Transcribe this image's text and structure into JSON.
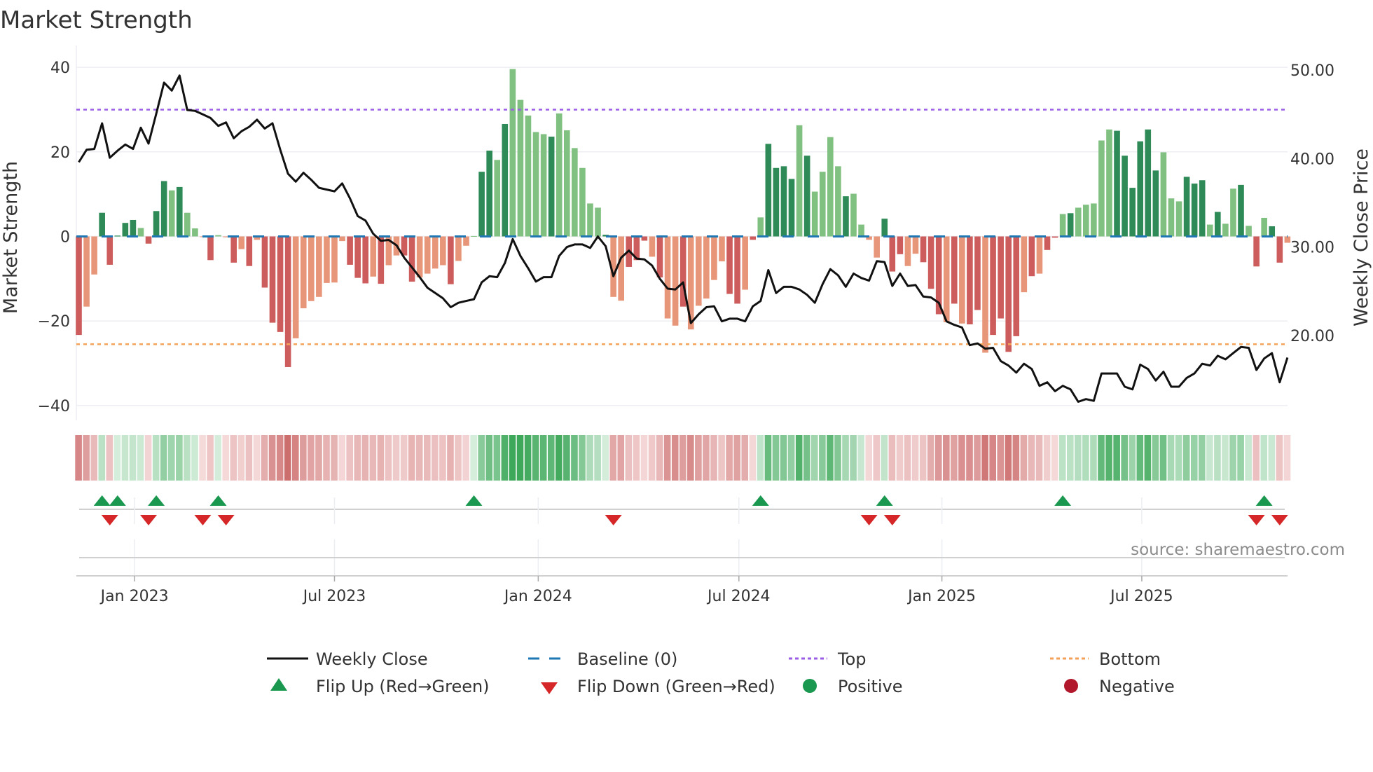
{
  "chart_data": {
    "type": "bar",
    "title": "Market Strength",
    "ylabel": "Market Strength",
    "y2label": "Weekly Close Price",
    "ylim": [
      -43.5,
      43.5
    ],
    "y2lim": [
      10.4,
      52.0
    ],
    "yticks": [
      {
        "v": 40,
        "label": "40"
      },
      {
        "v": 20,
        "label": "20"
      },
      {
        "v": 0,
        "label": "0"
      },
      {
        "v": -20,
        "label": "−20"
      },
      {
        "v": -40,
        "label": "−40"
      }
    ],
    "y2ticks": [
      {
        "v": 50,
        "label": "50.00"
      },
      {
        "v": 40,
        "label": "40.00"
      },
      {
        "v": 30,
        "label": "30.00"
      },
      {
        "v": 20,
        "label": "20.00"
      }
    ],
    "xticks": [
      {
        "week": 7.2,
        "label": "Jan 2023"
      },
      {
        "week": 33.0,
        "label": "Jul 2023"
      },
      {
        "week": 59.3,
        "label": "Jan 2024"
      },
      {
        "week": 85.2,
        "label": "Jul 2024"
      },
      {
        "week": 111.4,
        "label": "Jan 2025"
      },
      {
        "week": 137.2,
        "label": "Jul 2025"
      }
    ],
    "top_level": 30,
    "bottom_level": -25.5,
    "baseline": 0,
    "strength": [
      -23.3,
      -16.6,
      -9.0,
      5.6,
      -6.7,
      0.2,
      3.2,
      3.9,
      2.0,
      -1.7,
      6.0,
      13.1,
      10.9,
      11.7,
      5.6,
      1.9,
      -0.1,
      -5.6,
      0.3,
      -0.2,
      -6.2,
      -3.0,
      -7.0,
      -0.8,
      -12.1,
      -20.4,
      -22.6,
      -30.9,
      -24.1,
      -17.0,
      -15.3,
      -14.3,
      -11.0,
      -10.9,
      -1.1,
      -6.7,
      -9.8,
      -11.1,
      -9.5,
      -11.2,
      -6.8,
      -4.5,
      -4.5,
      -10.7,
      -9.7,
      -8.8,
      -7.6,
      -6.8,
      -11.3,
      -5.8,
      -2.2,
      0.1,
      15.3,
      20.3,
      18.1,
      26.6,
      39.6,
      32.3,
      28.6,
      24.7,
      24.2,
      23.6,
      29.1,
      25.1,
      20.9,
      16.2,
      7.8,
      6.8,
      0.4,
      -14.3,
      -15.2,
      -7.2,
      -5.6,
      -1.0,
      -4.8,
      -9.7,
      -19.4,
      -21.1,
      -16.6,
      -22.0,
      -16.4,
      -14.7,
      -10.3,
      -5.9,
      -13.6,
      -15.9,
      -12.6,
      -0.8,
      4.5,
      21.9,
      16.2,
      16.6,
      13.6,
      26.3,
      19.1,
      10.6,
      15.3,
      23.5,
      16.6,
      9.5,
      10.1,
      2.8,
      -0.8,
      -5.0,
      4.2,
      -8.3,
      -4.2,
      -7.0,
      -4.1,
      -6.1,
      -12.4,
      -18.4,
      -20.3,
      -15.9,
      -20.6,
      -20.8,
      -17.4,
      -27.5,
      -23.3,
      -19.4,
      -27.3,
      -23.6,
      -13.2,
      -9.4,
      -8.8,
      -3.2,
      -0.3,
      5.3,
      5.5,
      6.8,
      7.5,
      7.8,
      22.7,
      25.3,
      25.0,
      19.1,
      11.5,
      22.5,
      25.3,
      15.6,
      19.9,
      9.0,
      8.3,
      14.1,
      12.5,
      13.3,
      2.8,
      5.8,
      3.0,
      11.3,
      12.2,
      2.5,
      -7.1,
      4.4,
      2.4,
      -6.2,
      -1.5
    ],
    "shade": "dlldddddldddldllldlldldlddddllllllldddldlldd lllldlllddldllllldlllllldlldddldlldlllllddldlddddldlllldlllldddlldddldlddlddddldlddldlllllddddddllldddldlldldlddlddldl",
    "weekly_close": [
      39.6,
      41.0,
      41.1,
      44.0,
      40.1,
      40.9,
      41.6,
      41.1,
      43.5,
      41.7,
      45.1,
      48.6,
      47.7,
      49.4,
      45.5,
      45.4,
      45.0,
      44.6,
      43.7,
      44.1,
      42.3,
      43.1,
      43.6,
      44.4,
      43.4,
      44.0,
      41.0,
      38.3,
      37.4,
      38.4,
      37.6,
      36.7,
      36.5,
      36.3,
      37.2,
      35.5,
      33.5,
      33.0,
      31.5,
      30.7,
      30.8,
      30.2,
      28.8,
      27.7,
      26.6,
      25.4,
      24.8,
      24.2,
      23.2,
      23.7,
      23.9,
      24.1,
      26.0,
      26.7,
      26.6,
      28.2,
      30.9,
      29.0,
      27.6,
      26.1,
      26.6,
      26.6,
      29.0,
      30.0,
      30.3,
      30.3,
      29.9,
      31.2,
      30.1,
      26.7,
      28.8,
      29.6,
      28.7,
      28.6,
      27.9,
      26.4,
      25.3,
      25.2,
      26.0,
      21.4,
      22.4,
      23.2,
      23.3,
      21.6,
      21.9,
      21.9,
      21.6,
      23.3,
      23.9,
      27.4,
      24.8,
      25.5,
      25.5,
      25.2,
      24.6,
      23.7,
      25.8,
      27.5,
      26.8,
      25.5,
      27.0,
      26.5,
      26.2,
      28.4,
      28.3,
      25.6,
      27.0,
      25.6,
      25.7,
      24.4,
      24.3,
      23.7,
      21.6,
      21.2,
      20.9,
      18.9,
      19.1,
      18.5,
      18.6,
      17.1,
      16.6,
      15.8,
      16.8,
      16.2,
      14.3,
      14.7,
      13.7,
      14.3,
      13.9,
      12.5,
      12.8,
      12.6,
      15.7,
      15.7,
      15.7,
      14.2,
      13.9,
      16.7,
      16.2,
      14.9,
      15.9,
      14.2,
      14.2,
      15.2,
      15.7,
      16.8,
      16.6,
      17.7,
      17.3,
      18.0,
      18.7,
      18.6,
      16.1,
      17.4,
      18.0,
      14.7,
      17.5
    ],
    "flip_up_weeks": [
      3,
      5,
      10,
      18,
      51,
      88,
      104,
      127,
      153
    ],
    "flip_down_weeks": [
      4,
      9,
      16,
      19,
      69,
      102,
      105,
      152,
      155
    ],
    "legend": {
      "placement": "bottom",
      "weekly_close": "Weekly Close",
      "baseline": "Baseline (0)",
      "top": "Top",
      "bottom": "Bottom",
      "flip_up": "Flip Up (Red→Green)",
      "flip_down": "Flip Down (Green→Red)",
      "positive": "Positive",
      "negative": "Negative"
    },
    "source": "source: sharemaestro.com",
    "colors": {
      "pos_dark": "#2e8b57",
      "pos_light": "#80c080",
      "neg_dark": "#cd5c5c",
      "neg_light": "#e8967a",
      "line": "#111111",
      "baseline": "#1f77b4",
      "top": "#9b5de5",
      "bottom": "#f4a259",
      "flip_up": "#1a9850",
      "flip_down": "#d62728",
      "positive": "#1a9850",
      "negative": "#b2182b"
    }
  }
}
